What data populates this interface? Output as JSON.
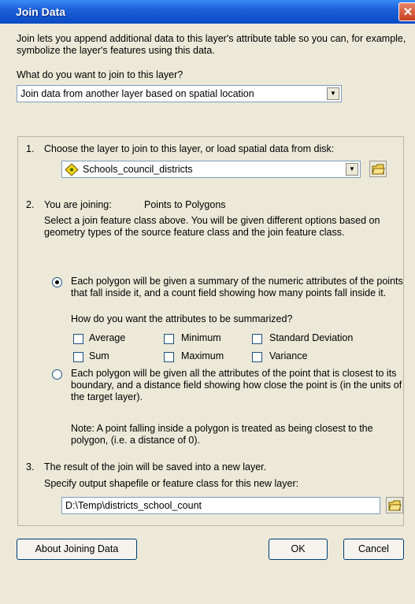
{
  "window": {
    "title": "Join Data"
  },
  "intro": "Join lets you append additional data to this layer's attribute table so you can, for example, symbolize the layer's features using this data.",
  "question": "What do you want to join to this layer?",
  "join_type": {
    "selected": "Join data from another layer based on spatial location"
  },
  "step1": {
    "number": "1.",
    "label": "Choose the layer to join to this layer, or load spatial data from disk:",
    "layer": {
      "selected": "Schools_council_districts",
      "icon": "point-layer-icon"
    }
  },
  "step2": {
    "number": "2.",
    "label": "You are joining:",
    "join_kind": "Points to Polygons",
    "description": "Select a join feature class above.  You will be given different options based on geometry types of the source feature class and the join feature class.",
    "option_summary": "Each polygon will be given a summary of the numeric attributes of the points that fall inside it, and a count field showing how many points fall inside it.",
    "summarize_question": "How do you want the attributes to be summarized?",
    "checkboxes": {
      "average": "Average",
      "minimum": "Minimum",
      "std_dev": "Standard Deviation",
      "sum": "Sum",
      "maximum": "Maximum",
      "variance": "Variance"
    },
    "option_closest": "Each polygon will be given all the attributes of the point that is closest to its boundary, and a distance field showing how close the point is (in the units of the target layer).",
    "note": "Note: A point falling inside a polygon is treated as being closest to the polygon, (i.e. a distance of 0)."
  },
  "step3": {
    "number": "3.",
    "label": "The result of the join will be saved into a new layer.",
    "sublabel": "Specify output shapefile or feature class for this new layer:",
    "output_path": "D:\\Temp\\districts_school_count"
  },
  "buttons": {
    "about": "About Joining Data",
    "ok": "OK",
    "cancel": "Cancel"
  },
  "colors": {
    "titlebar": "#0a4ac6",
    "dialog_bg": "#ece9d8",
    "close": "#c8401c"
  }
}
